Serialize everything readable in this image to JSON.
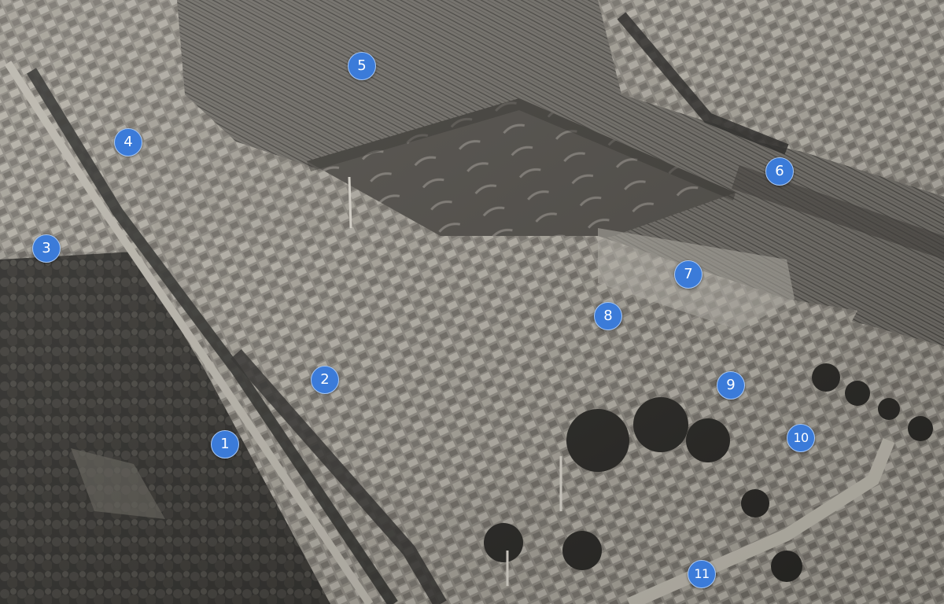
{
  "image": {
    "description_icon": "aerial-photograph",
    "tone": "sepia-greyscale"
  },
  "markers": [
    {
      "label": "1"
    },
    {
      "label": "2"
    },
    {
      "label": "3"
    },
    {
      "label": "4"
    },
    {
      "label": "5"
    },
    {
      "label": "6"
    },
    {
      "label": "7"
    },
    {
      "label": "8"
    },
    {
      "label": "9"
    },
    {
      "label": "10"
    },
    {
      "label": "11"
    }
  ],
  "colors": {
    "marker_fill": "#3b7bd9",
    "marker_text": "#ffffff"
  }
}
